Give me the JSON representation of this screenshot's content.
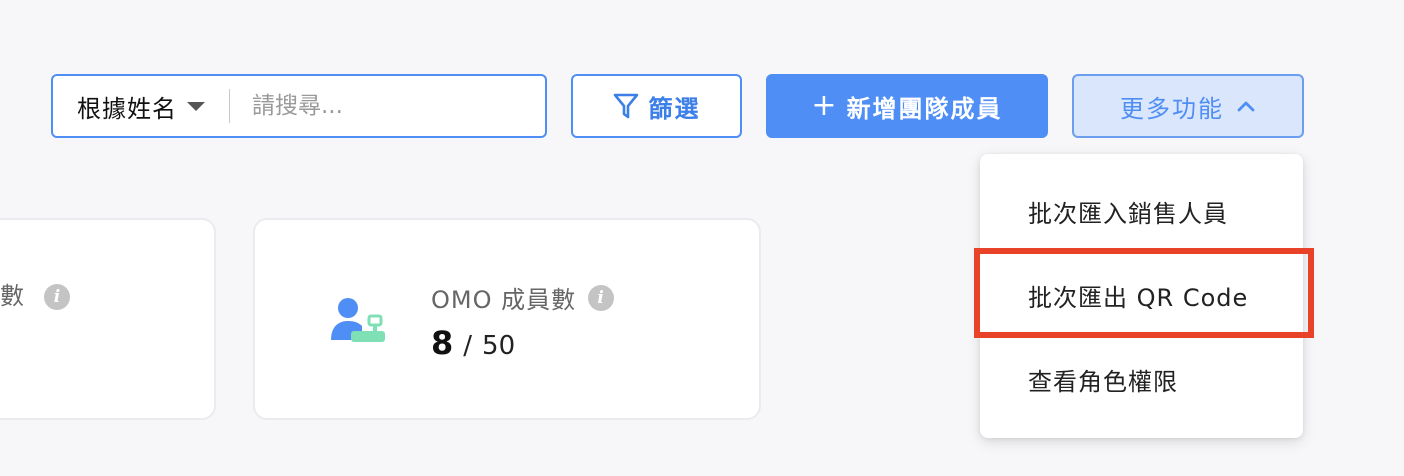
{
  "toolbar": {
    "search_field_selected": "根據姓名",
    "search_placeholder": "請搜尋...",
    "filter_label": "篩選",
    "add_member_label": "新增團隊成員",
    "more_label": "更多功能"
  },
  "cards": {
    "left_card_label_partial": "數",
    "omo": {
      "title": "OMO 成員數",
      "current": "8",
      "separator": "/",
      "max": "50"
    }
  },
  "dropdown": {
    "items": [
      {
        "label": "批次匯入銷售人員"
      },
      {
        "label": "批次匯出 QR Code",
        "highlighted": true
      },
      {
        "label": "查看角色權限"
      }
    ]
  },
  "icons": {
    "info": "i",
    "add": "+"
  },
  "colors": {
    "accent": "#4f8ef5",
    "highlight_border": "#e84228",
    "icon_green": "#7ee0b4"
  }
}
